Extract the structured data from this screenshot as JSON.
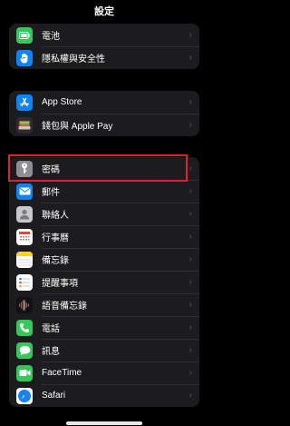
{
  "header": {
    "title": "設定"
  },
  "groups": [
    {
      "items": [
        {
          "label": "電池",
          "icon": "battery-icon",
          "color": "#34c759"
        },
        {
          "label": "隱私權與安全性",
          "icon": "hand-icon",
          "color": "#0a84ff"
        }
      ]
    },
    {
      "items": [
        {
          "label": "App Store",
          "icon": "app-store-icon",
          "color": "#0a84ff"
        },
        {
          "label": "錢包與 Apple Pay",
          "icon": "wallet-icon",
          "color": "#2c2c2e"
        }
      ]
    },
    {
      "items": [
        {
          "label": "密碼",
          "icon": "key-icon",
          "color": "#8e8e93",
          "highlighted": true
        },
        {
          "label": "郵件",
          "icon": "mail-icon",
          "color": "#0a84ff"
        },
        {
          "label": "聯絡人",
          "icon": "contacts-icon",
          "color": "#9d9da2"
        },
        {
          "label": "行事曆",
          "icon": "calendar-icon",
          "color": "#ffffff"
        },
        {
          "label": "備忘錄",
          "icon": "notes-icon",
          "color": "#ffd60a"
        },
        {
          "label": "提醒事項",
          "icon": "reminders-icon",
          "color": "#ffffff"
        },
        {
          "label": "語音備忘錄",
          "icon": "voice-memos-icon",
          "color": "#1c1c1e"
        },
        {
          "label": "電話",
          "icon": "phone-icon",
          "color": "#34c759"
        },
        {
          "label": "訊息",
          "icon": "messages-icon",
          "color": "#34c759"
        },
        {
          "label": "FaceTime",
          "icon": "facetime-icon",
          "color": "#34c759"
        },
        {
          "label": "Safari",
          "icon": "safari-icon",
          "color": "#0a84ff"
        }
      ]
    }
  ],
  "chevron": "›"
}
